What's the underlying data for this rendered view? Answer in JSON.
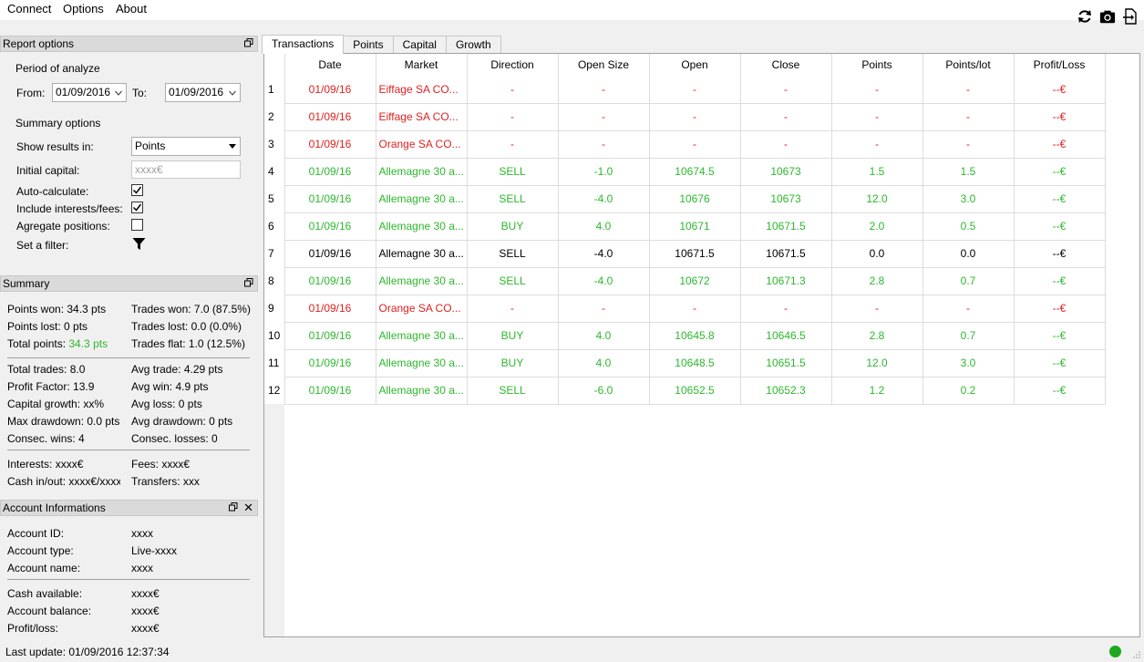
{
  "menu": {
    "items": [
      "Connect",
      "Options",
      "About"
    ]
  },
  "toolbar": {
    "icons": [
      "refresh-icon",
      "camera-icon",
      "export-icon"
    ]
  },
  "report_options": {
    "title": "Report options",
    "period_label": "Period of analyze",
    "from_label": "From:",
    "from_value": "01/09/2016",
    "to_label": "To:",
    "to_value": "01/09/2016",
    "summary_options_label": "Summary options",
    "show_results_label": "Show results in:",
    "show_results_value": "Points",
    "initial_capital_label": "Initial capital:",
    "initial_capital_placeholder": "xxxx€",
    "auto_calculate_label": "Auto-calculate:",
    "auto_calculate_checked": true,
    "include_fees_label": "Include interests/fees:",
    "include_fees_checked": true,
    "aggregate_label": "Agregate positions:",
    "aggregate_checked": false,
    "filter_label": "Set a filter:"
  },
  "summary": {
    "title": "Summary",
    "points_won": "Points won: 34.3 pts",
    "trades_won": "Trades won: 7.0 (87.5%)",
    "points_lost": "Points lost: 0 pts",
    "trades_lost": "Trades lost: 0.0 (0.0%)",
    "total_points_label": "Total points: ",
    "total_points_value": "34.3 pts",
    "trades_flat": "Trades flat: 1.0 (12.5%)",
    "total_trades": "Total trades: 8.0",
    "avg_trade": "Avg trade: 4.29 pts",
    "profit_factor": "Profit Factor: 13.9",
    "avg_win": "Avg win: 4.9 pts",
    "capital_growth": "Capital growth: xx%",
    "avg_loss": "Avg loss: 0 pts",
    "max_drawdown": "Max drawdown: 0.0 pts",
    "avg_drawdown": "Avg drawdown: 0 pts",
    "consec_wins": "Consec. wins: 4",
    "consec_losses": "Consec. losses: 0",
    "interests": "Interests: xxxx€",
    "fees": "Fees: xxxx€",
    "cash_inout": "Cash in/out: xxxx€/xxxx€",
    "transfers": "Transfers: xxxx"
  },
  "account": {
    "title": "Account Informations",
    "id_label": "Account ID:",
    "id_value": "xxxx",
    "type_label": "Account type:",
    "type_value": "Live-xxxx",
    "name_label": "Account name:",
    "name_value": "xxxx",
    "cash_label": "Cash available:",
    "cash_value": "xxxx€",
    "balance_label": "Account balance:",
    "balance_value": "xxxx€",
    "pl_label": "Profit/loss:",
    "pl_value": "xxxx€"
  },
  "tabs": [
    "Transactions",
    "Points",
    "Capital",
    "Growth"
  ],
  "table": {
    "columns": [
      "Date",
      "Market",
      "Direction",
      "Open Size",
      "Open",
      "Close",
      "Points",
      "Points/lot",
      "Profit/Loss"
    ],
    "rows": [
      {
        "n": "1",
        "color": "red",
        "cells": [
          "01/09/16",
          "Eiffage SA CO...",
          "-",
          "-",
          "-",
          "-",
          "-",
          "-",
          "--€"
        ]
      },
      {
        "n": "2",
        "color": "red",
        "cells": [
          "01/09/16",
          "Eiffage SA CO...",
          "-",
          "-",
          "-",
          "-",
          "-",
          "-",
          "--€"
        ]
      },
      {
        "n": "3",
        "color": "red",
        "cells": [
          "01/09/16",
          "Orange SA CO...",
          "-",
          "-",
          "-",
          "-",
          "-",
          "-",
          "--€"
        ]
      },
      {
        "n": "4",
        "color": "green",
        "cells": [
          "01/09/16",
          "Allemagne 30 a...",
          "SELL",
          "-1.0",
          "10674.5",
          "10673",
          "1.5",
          "1.5",
          "--€"
        ]
      },
      {
        "n": "5",
        "color": "green",
        "cells": [
          "01/09/16",
          "Allemagne 30 a...",
          "SELL",
          "-4.0",
          "10676",
          "10673",
          "12.0",
          "3.0",
          "--€"
        ]
      },
      {
        "n": "6",
        "color": "green",
        "cells": [
          "01/09/16",
          "Allemagne 30 a...",
          "BUY",
          "4.0",
          "10671",
          "10671.5",
          "2.0",
          "0.5",
          "--€"
        ]
      },
      {
        "n": "7",
        "color": "black",
        "cells": [
          "01/09/16",
          "Allemagne 30 a...",
          "SELL",
          "-4.0",
          "10671.5",
          "10671.5",
          "0.0",
          "0.0",
          "--€"
        ]
      },
      {
        "n": "8",
        "color": "green",
        "cells": [
          "01/09/16",
          "Allemagne 30 a...",
          "SELL",
          "-4.0",
          "10672",
          "10671.3",
          "2.8",
          "0.7",
          "--€"
        ]
      },
      {
        "n": "9",
        "color": "red",
        "cells": [
          "01/09/16",
          "Orange SA CO...",
          "-",
          "-",
          "-",
          "-",
          "-",
          "-",
          "--€"
        ]
      },
      {
        "n": "10",
        "color": "green",
        "cells": [
          "01/09/16",
          "Allemagne 30 a...",
          "BUY",
          "4.0",
          "10645.8",
          "10646.5",
          "2.8",
          "0.7",
          "--€"
        ]
      },
      {
        "n": "11",
        "color": "green",
        "cells": [
          "01/09/16",
          "Allemagne 30 a...",
          "BUY",
          "4.0",
          "10648.5",
          "10651.5",
          "12.0",
          "3.0",
          "--€"
        ]
      },
      {
        "n": "12",
        "color": "green",
        "cells": [
          "01/09/16",
          "Allemagne 30 a...",
          "SELL",
          "-6.0",
          "10652.5",
          "10652.3",
          "1.2",
          "0.2",
          "--€"
        ]
      }
    ]
  },
  "status": {
    "last_update": "Last update: 01/09/2016 12:37:34",
    "connection_color": "#1fa81f"
  },
  "colors": {
    "profit": "#2db82d",
    "loss": "#e02020"
  }
}
